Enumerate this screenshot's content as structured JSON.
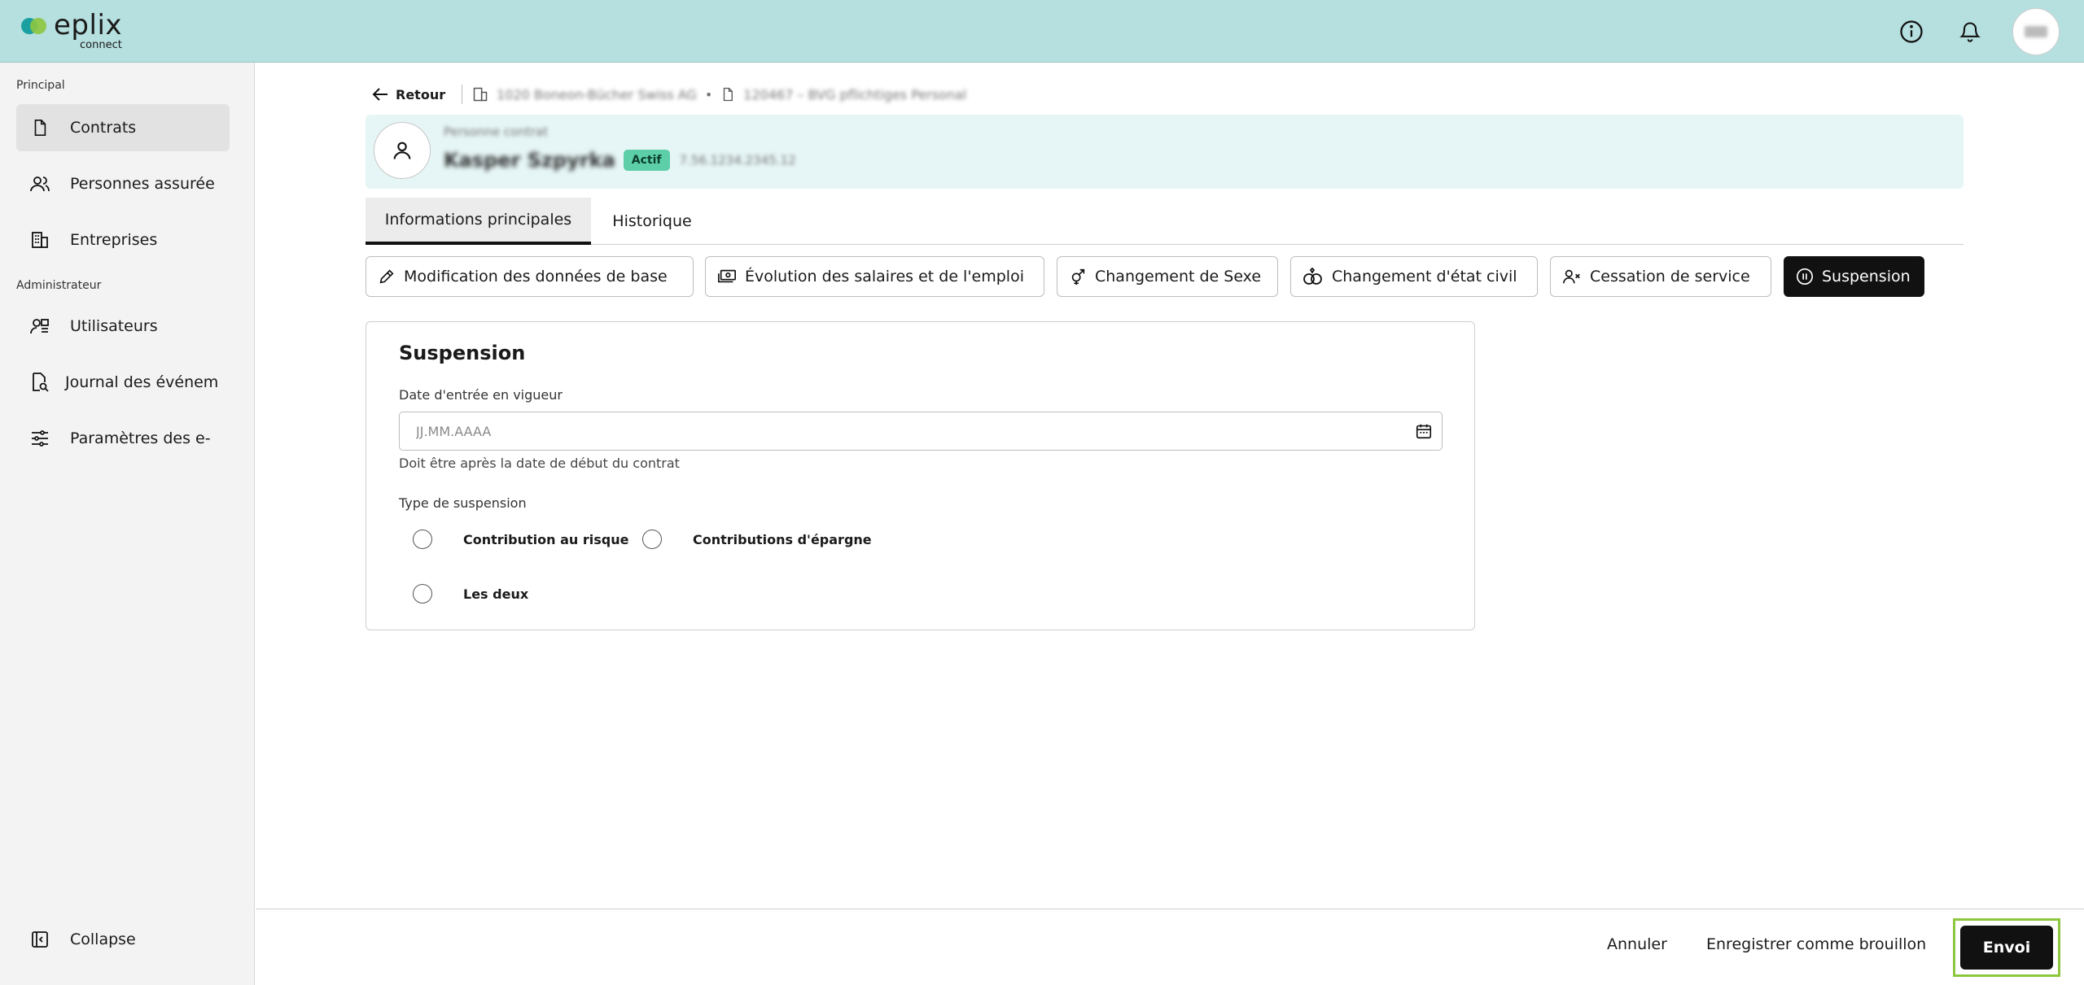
{
  "app": {
    "logo_word": "eplix",
    "logo_sub": "connect"
  },
  "topbar": {
    "icons": [
      "info-icon",
      "bell-icon",
      "avatar"
    ]
  },
  "sidebar": {
    "section_principal": "Principal",
    "section_admin": "Administrateur",
    "items": [
      {
        "label": "Contrats",
        "icon": "document-icon",
        "active": true
      },
      {
        "label": "Personnes assurée",
        "icon": "users-icon"
      },
      {
        "label": "Entreprises",
        "icon": "building-icon"
      },
      {
        "label": "Utilisateurs",
        "icon": "user-admin-icon"
      },
      {
        "label": "Journal des événem",
        "icon": "document-search-icon"
      },
      {
        "label": "Paramètres des e-",
        "icon": "sliders-icon"
      }
    ],
    "collapse_label": "Collapse"
  },
  "breadcrumb": {
    "back_label": "Retour",
    "company": "1020 Boneon-Bücher Swiss AG",
    "contract": "120467 – BVG pflichtiges Personal"
  },
  "person": {
    "line1": "Personne contrat",
    "name": "Kasper Szpyrka",
    "status": "Actif",
    "ssn": "7.56.1234.2345.12"
  },
  "tabs": [
    {
      "label": "Informations principales",
      "active": true
    },
    {
      "label": "Historique",
      "active": false
    }
  ],
  "actions": [
    {
      "label": "Modification des données de base",
      "icon": "pencil-icon"
    },
    {
      "label": "Évolution des salaires et de l'emploi",
      "icon": "money-icon"
    },
    {
      "label": "Changement de Sexe",
      "icon": "gender-icon"
    },
    {
      "label": "Changement d'état civil",
      "icon": "rings-icon"
    },
    {
      "label": "Cessation de service",
      "icon": "user-remove-icon"
    },
    {
      "label": "Suspension",
      "icon": "pause-icon",
      "active": true
    }
  ],
  "form": {
    "title": "Suspension",
    "date_label": "Date d'entrée en vigueur",
    "date_value": "",
    "date_placeholder": "JJ.MM.AAAA",
    "date_hint": "Doit être après la date de début du contrat",
    "type_label": "Type de suspension",
    "options": [
      "Contribution au risque",
      "Contributions d'épargne",
      "Les deux"
    ]
  },
  "footer": {
    "cancel": "Annuler",
    "draft": "Enregistrer comme brouillon",
    "send": "Envoi"
  },
  "colors": {
    "topbar": "#b6dfdf",
    "accent_dark": "#111111",
    "badge": "#5ccfa8",
    "highlight": "#8dc63f"
  }
}
